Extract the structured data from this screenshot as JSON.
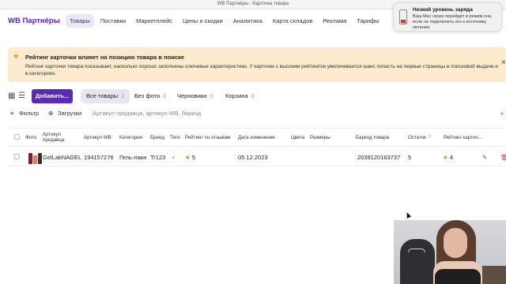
{
  "window": {
    "title": "WB Партнёры - Карточка товара"
  },
  "nav": {
    "logo": "WB Партнёры",
    "links": [
      "Товары",
      "Поставки",
      "Маркетплейс",
      "Цены и скидки",
      "Аналитика",
      "Карта складов",
      "Реклама",
      "Тарифы"
    ],
    "active_index": 0
  },
  "notification": {
    "title": "Низкий уровень заряда",
    "body": "Ваш Mac скоро перейдет в режим сна, если не подключить его к источнику питания."
  },
  "banner": {
    "icon": "star-icon",
    "title": "Рейтинг карточки влияет на позицию товара в поиске",
    "text": "Рейтинг карточки товара показывает, насколько хорошо заполнены ключевые характеристики. У карточек с высоким рейтингом увеличивается шанс попасть на первые страницы в поисковой выдаче и в категориях.",
    "close": "×"
  },
  "toolbar": {
    "add_label": "Добавить...",
    "tabs": [
      {
        "label": "Все товары",
        "count": "1"
      },
      {
        "label": "Без фото",
        "count": "0"
      },
      {
        "label": "Черновики",
        "count": "0"
      },
      {
        "label": "Корзина",
        "count": "0"
      }
    ]
  },
  "filters": {
    "filter_label": "Фильтр",
    "upload_label": "Загрузки",
    "search_placeholder": "Артикул продавца, артикул WB, баркод"
  },
  "table": {
    "headers": {
      "photo": "Фото",
      "seller_article": "Артикул продавца",
      "wb_article": "Артикул WB",
      "category": "Категория",
      "brand": "Бренд",
      "tags": "Теги",
      "review_rating": "Рейтинг по отзывам",
      "date_changed": "Дата изменения",
      "color": "Цвета",
      "sizes": "Размеры",
      "barcode": "Баркод товара",
      "stock": "Остаток",
      "card_rating": "Рейтинг карточ..."
    },
    "rows": [
      {
        "seller_article": "GelLakNAGEL",
        "wb_article": "194157276",
        "category": "Гель-лаки",
        "brand": "Tr123",
        "tags": "+",
        "review_rating": "5",
        "date_changed": "05.12.2023",
        "color": "",
        "sizes": "",
        "barcode": "2039120163737",
        "stock": "5",
        "card_rating": "4"
      }
    ]
  },
  "colors": {
    "brand": "#5a1fbf",
    "button": "#5b2bb4",
    "banner_bg": "#fcebcd",
    "star": "#e8842d",
    "delete": "#d9363e"
  }
}
